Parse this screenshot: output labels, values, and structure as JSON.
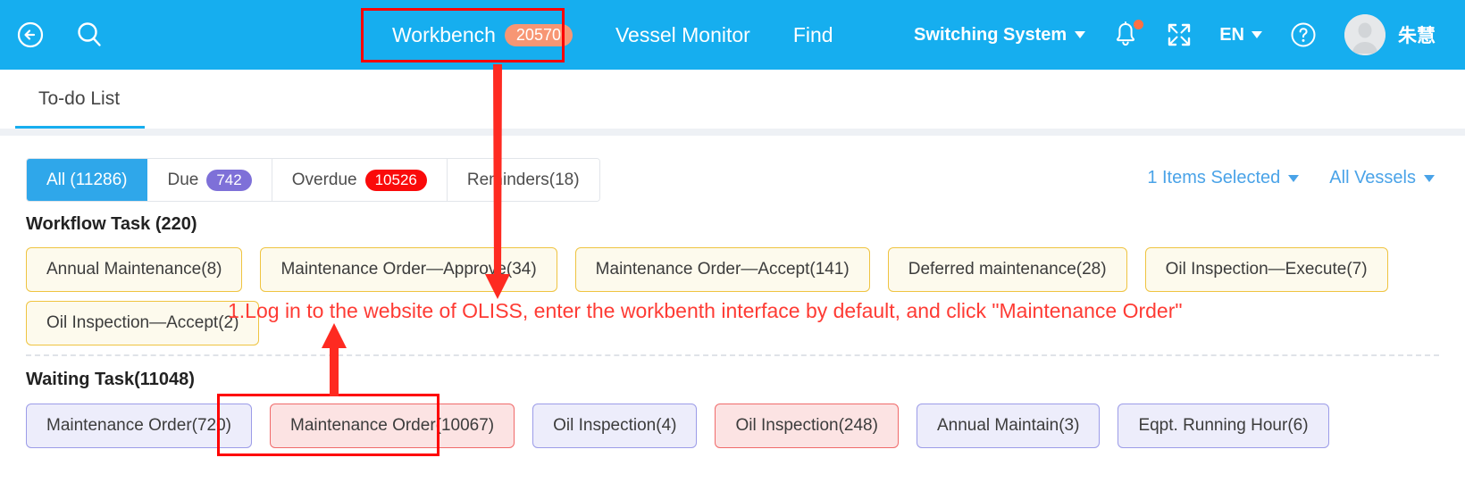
{
  "header": {
    "back_icon": "back-arrow-icon",
    "search_icon": "search-icon",
    "nav": [
      {
        "label": "Workbench",
        "badge": "20570",
        "active": true
      },
      {
        "label": "Vessel Monitor",
        "badge": "",
        "active": false
      },
      {
        "label": "Find",
        "badge": "",
        "active": false
      }
    ],
    "switch_system": "Switching System",
    "notification_icon": "bell-icon",
    "fullscreen_icon": "fullscreen-icon",
    "language": "EN",
    "help_icon": "question-mark-icon",
    "avatar_icon": "user-avatar-icon",
    "username": "朱慧",
    "bg_color": "#16AEEF",
    "badge_color": "#F79674"
  },
  "tabs": {
    "items": [
      {
        "label": "To-do List",
        "active": true
      }
    ],
    "accent_color": "#17AEEF"
  },
  "filters": {
    "items": [
      {
        "label": "All (11286)",
        "pill": "",
        "pill_style": "",
        "active": true
      },
      {
        "label": "Due",
        "pill": "742",
        "pill_style": "purple",
        "active": false
      },
      {
        "label": "Overdue",
        "pill": "10526",
        "pill_style": "red",
        "active": false
      },
      {
        "label": "Reminders(18)",
        "pill": "",
        "pill_style": "",
        "active": false
      }
    ],
    "active_color": "#2FA7EA",
    "due_pill_color": "#7E70D8",
    "overdue_pill_color": "#FA0A0A"
  },
  "toolbar_right": {
    "items_selected": "1 Items Selected",
    "vessel_filter": "All Vessels",
    "link_color": "#4AA3E8"
  },
  "workflow_task": {
    "title": "Workflow Task (220)",
    "row1": [
      {
        "label": "Annual Maintenance(8)",
        "style": "yellow"
      },
      {
        "label": "Maintenance Order—Approve(34)",
        "style": "yellow"
      },
      {
        "label": "Maintenance Order—Accept(141)",
        "style": "yellow"
      },
      {
        "label": "Deferred maintenance(28)",
        "style": "yellow"
      },
      {
        "label": "Oil Inspection—Execute(7)",
        "style": "yellow"
      }
    ],
    "row2": [
      {
        "label": "Oil Inspection—Accept(2)",
        "style": "yellow"
      }
    ]
  },
  "waiting_task": {
    "title": "Waiting Task(11048)",
    "row1": [
      {
        "label": "Maintenance Order(720)",
        "style": "blue"
      },
      {
        "label": "Maintenance Order(10067)",
        "style": "pink"
      },
      {
        "label": "Oil Inspection(4)",
        "style": "blue"
      },
      {
        "label": "Oil Inspection(248)",
        "style": "pink"
      },
      {
        "label": "Annual Maintain(3)",
        "style": "blue"
      },
      {
        "label": "Eqpt. Running Hour(6)",
        "style": "blue"
      }
    ]
  },
  "annotation": {
    "step_text": "1.Log in to the website of OLISS, enter the workbenth interface by default, and click \"Maintenance Order\"",
    "color": "#FE3B34",
    "box_color": "#FE0000"
  }
}
